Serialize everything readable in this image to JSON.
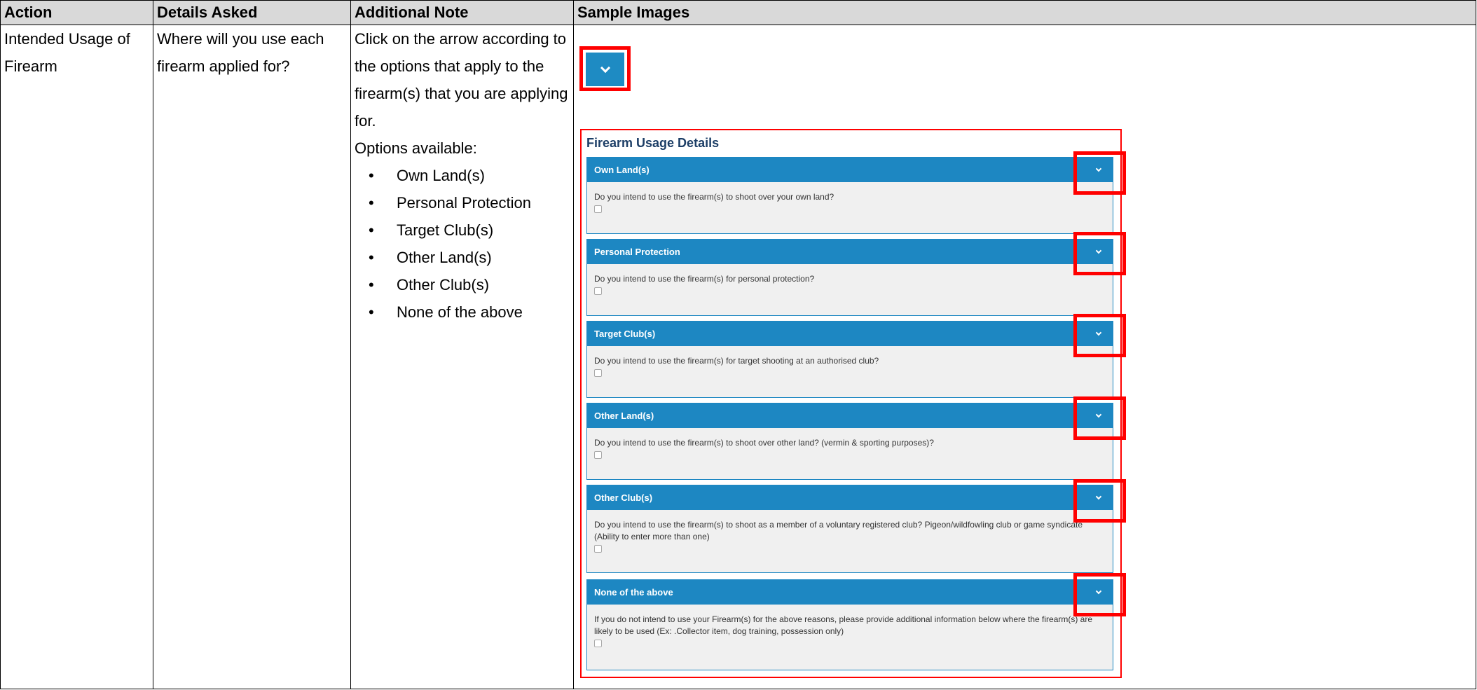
{
  "table": {
    "headers": [
      "Action",
      "Details Asked",
      "Additional Note",
      "Sample Images"
    ],
    "action": "Intended Usage of Firearm",
    "details": "Where will you use each firearm applied for?",
    "note_intro": "Click on the arrow according to the options that apply to the firearm(s) that you are applying for.",
    "note_options_label": "Options available:",
    "options": [
      "Own Land(s)",
      "Personal Protection",
      "Target Club(s)",
      "Other Land(s)",
      "Other Club(s)",
      "None of the above"
    ]
  },
  "sample": {
    "section_title": "Firearm Usage Details",
    "panels": [
      {
        "title": "Own Land(s)",
        "question": "Do you intend to use the firearm(s) to shoot over your own land?"
      },
      {
        "title": "Personal Protection",
        "question": "Do you intend to use the firearm(s) for personal protection?"
      },
      {
        "title": "Target Club(s)",
        "question": "Do you intend to use the firearm(s) for target shooting at an authorised club?"
      },
      {
        "title": "Other Land(s)",
        "question": "Do you intend to use the firearm(s) to shoot over other land? (vermin & sporting purposes)?"
      },
      {
        "title": "Other Club(s)",
        "question": "Do you intend to use the firearm(s) to shoot as a member of a voluntary registered club? Pigeon/wildfowling club or game syndicate (Ability to enter more than one)"
      },
      {
        "title": "None of the above",
        "question": "If you do not intend to use your Firearm(s) for the above reasons, please provide additional information below where the firearm(s) are likely to be used (Ex: .Collector item, dog training, possession only)"
      }
    ],
    "colors": {
      "accent": "#1d87c2",
      "highlight": "#ff0000",
      "title": "#1c3e66"
    }
  }
}
